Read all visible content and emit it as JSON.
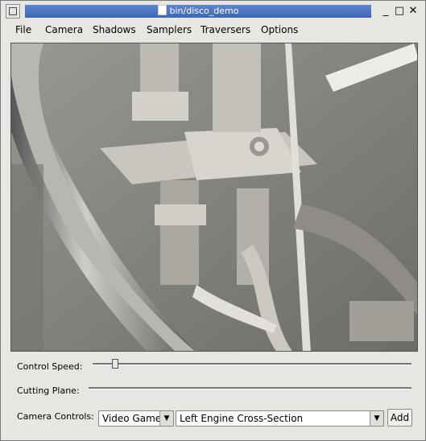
{
  "window": {
    "title": "bin/disco_demo",
    "minimize_glyph": "_",
    "maximize_glyph": "□",
    "close_glyph": "✕"
  },
  "menu": [
    "File",
    "Camera",
    "Shadows",
    "Samplers",
    "Traversers",
    "Options"
  ],
  "viewport": {
    "content": "grayscale rendered engine cross-section"
  },
  "controls": {
    "speed_label": "Control Speed:",
    "speed_value": 0.07,
    "cutting_label": "Cutting Plane:",
    "camera_label": "Camera Controls:",
    "camera_mode": "Video Game",
    "camera_preset": "Left Engine Cross-Section",
    "add_label": "Add"
  }
}
